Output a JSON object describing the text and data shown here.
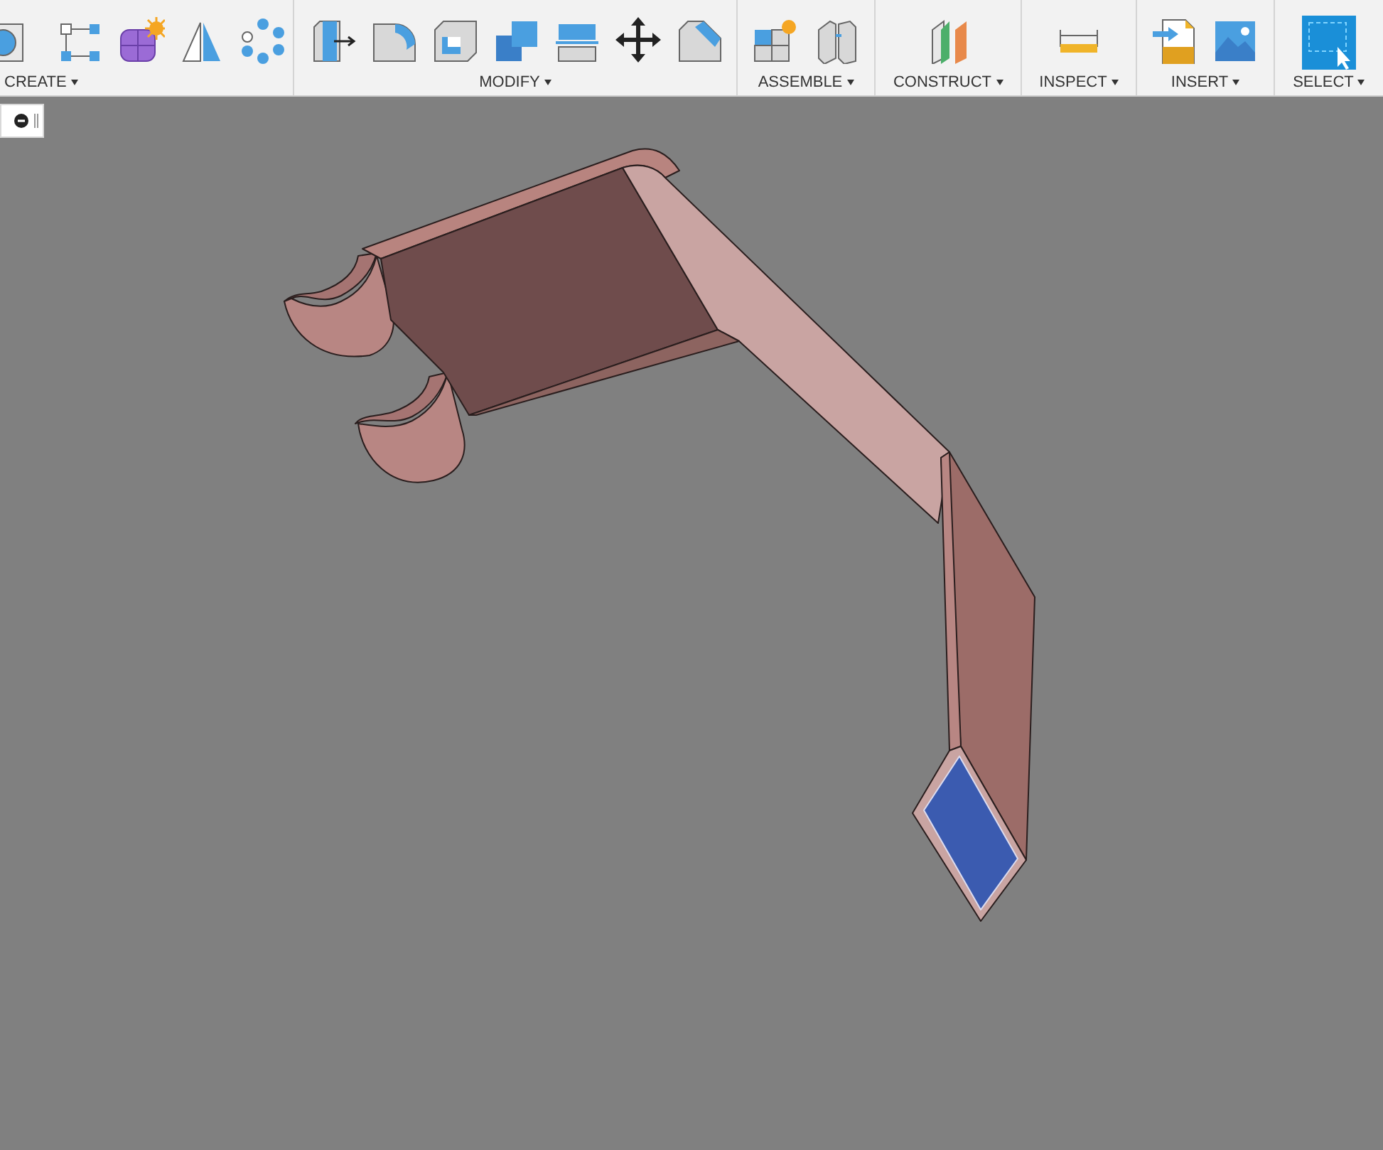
{
  "toolbar": {
    "groups": [
      {
        "label": "CREATE"
      },
      {
        "label": "MODIFY"
      },
      {
        "label": "ASSEMBLE"
      },
      {
        "label": "CONSTRUCT"
      },
      {
        "label": "INSPECT"
      },
      {
        "label": "INSERT"
      },
      {
        "label": "SELECT"
      }
    ]
  }
}
